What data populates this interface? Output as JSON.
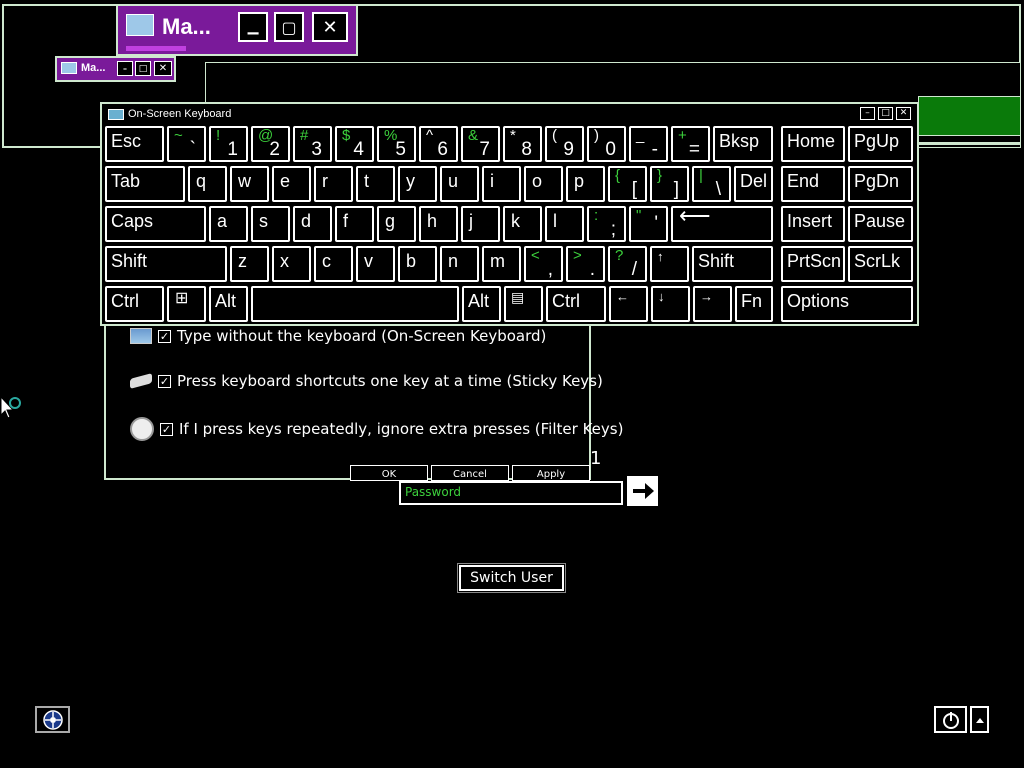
{
  "background_windows": {
    "large_title": "Ma...",
    "small_title": "Ma..."
  },
  "osk": {
    "title": "On-Screen Keyboard",
    "controls": {
      "minimize": "–",
      "maximize": "□",
      "close": "✕"
    },
    "keys": {
      "esc": "Esc",
      "tilde_shift": "~",
      "tilde": "`",
      "k1s": "!",
      "k1": "1",
      "k2s": "@",
      "k2": "2",
      "k3s": "#",
      "k3": "3",
      "k4s": "$",
      "k4": "4",
      "k5s": "%",
      "k5": "5",
      "k6s": "^",
      "k6": "6",
      "k7s": "&",
      "k7": "7",
      "k8s": "*",
      "k8": "8",
      "k9s": "(",
      "k9": "9",
      "k0s": ")",
      "k0": "0",
      "minus_s": "_",
      "minus": "-",
      "plus_s": "+",
      "equal": "=",
      "bksp": "Bksp",
      "home": "Home",
      "pgup": "PgUp",
      "tab": "Tab",
      "q": "q",
      "w": "w",
      "e": "e",
      "r": "r",
      "t": "t",
      "y": "y",
      "u": "u",
      "i": "i",
      "o": "o",
      "p": "p",
      "lbrace": "{",
      "lbracket": "[",
      "rbrace": "}",
      "rbracket": "]",
      "pipe": "|",
      "backslash": "\\",
      "del": "Del",
      "end": "End",
      "pgdn": "PgDn",
      "caps": "Caps",
      "a": "a",
      "s": "s",
      "d": "d",
      "f": "f",
      "g": "g",
      "h": "h",
      "j": "j",
      "k": "k",
      "l": "l",
      "colon": ":",
      "semicolon": ";",
      "quote_s": "\"",
      "quote": "'",
      "enter": "⟵",
      "insert": "Insert",
      "pause": "Pause",
      "shift_l": "Shift",
      "z": "z",
      "x": "x",
      "c": "c",
      "v": "v",
      "b": "b",
      "n": "n",
      "m": "m",
      "lt": "<",
      "comma": ",",
      "gt": ">",
      "period": ".",
      "question": "?",
      "slash": "/",
      "up": "↑",
      "shift_r": "Shift",
      "prtscn": "PrtScn",
      "scrlk": "ScrLk",
      "ctrl_l": "Ctrl",
      "win": "⊞",
      "alt_l": "Alt",
      "alt_r": "Alt",
      "menu": "▤",
      "ctrl_r": "Ctrl",
      "left": "←",
      "down": "↓",
      "right": "→",
      "fn": "Fn",
      "options": "Options"
    }
  },
  "ease_dialog": {
    "options": [
      {
        "label": "Type without the keyboard (On-Screen Keyboard)",
        "checked": true
      },
      {
        "label": "Press keyboard shortcuts one key at a time (Sticky Keys)",
        "checked": true
      },
      {
        "label": "If I press keys repeatedly, ignore extra presses (Filter Keys)",
        "checked": true
      }
    ],
    "ok": "OK",
    "cancel": "Cancel",
    "apply": "Apply"
  },
  "login": {
    "counter": "1",
    "password_placeholder": "Password",
    "switch_user": "Switch User"
  },
  "colors": {
    "accent_green": "#3cd03c",
    "purple": "#7a1a9a",
    "titlebar_green": "#0a7a0a"
  }
}
